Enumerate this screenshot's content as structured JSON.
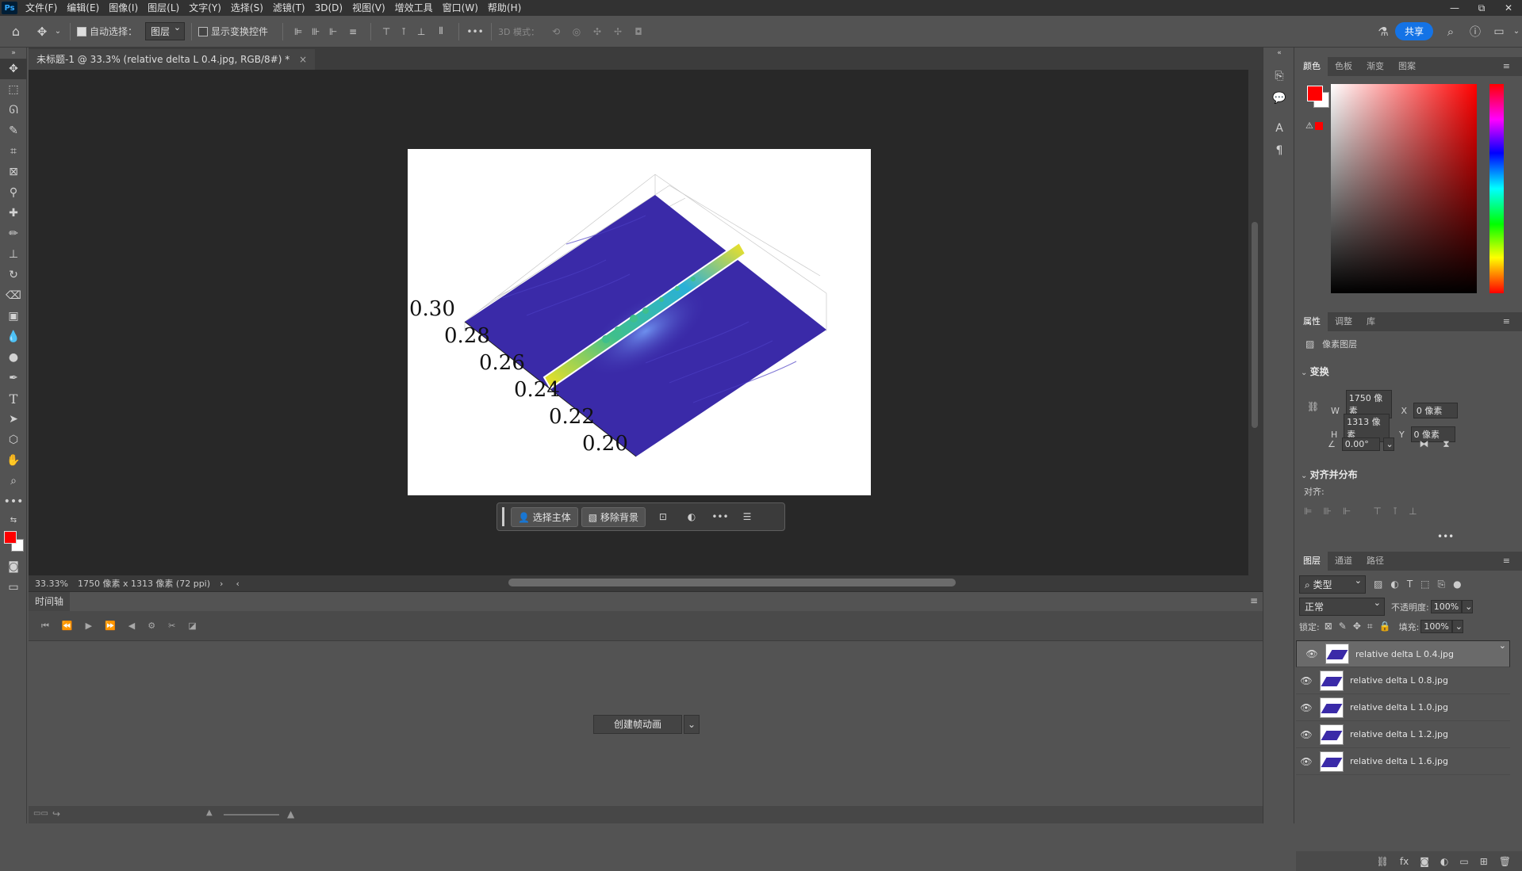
{
  "app": {
    "logo": "Ps"
  },
  "menu": [
    "文件(F)",
    "编辑(E)",
    "图像(I)",
    "图层(L)",
    "文字(Y)",
    "选择(S)",
    "滤镜(T)",
    "3D(D)",
    "视图(V)",
    "增效工具",
    "窗口(W)",
    "帮助(H)"
  ],
  "window_controls": {
    "minimize": "—",
    "restore": "⧉",
    "close": "✕"
  },
  "options": {
    "auto_select_label": "自动选择：",
    "auto_select_value": "图层",
    "show_transform_label": "显示变换控件",
    "mode_3d_label": "3D 模式：",
    "share_label": "共享"
  },
  "document": {
    "tab_title": "未标题-1 @ 33.3% (relative delta L 0.4.jpg, RGB/8#) *",
    "tab_close": "×"
  },
  "chart_data": {
    "type": "surface",
    "axis_tick_labels": [
      "0.30",
      "0.28",
      "0.26",
      "0.24",
      "0.22",
      "0.20"
    ],
    "colors": {
      "base": "#3a2aa8",
      "ridge_high": "#f7e31e",
      "ridge_mid": "#3fbf8c"
    }
  },
  "context_bar": {
    "select_subject": "选择主体",
    "remove_background": "移除背景",
    "more": "•••"
  },
  "status": {
    "zoom": "33.33%",
    "doc_size": "1750 像素 x 1313 像素 (72 ppi)",
    "arrow_right": "›",
    "arrow_left": "‹"
  },
  "timeline": {
    "tab": "时间轴",
    "create_button": "创建帧动画",
    "dropdown": "⌄"
  },
  "color_panel": {
    "tabs": [
      "颜色",
      "色板",
      "渐变",
      "图案"
    ],
    "fg_color": "#ff0000",
    "bg_color": "#ffffff"
  },
  "properties_panel": {
    "tabs": [
      "属性",
      "调整",
      "库"
    ],
    "layer_type": "像素图层",
    "transform_title": "变换",
    "w_label": "W",
    "w_value": "1750 像素",
    "h_label": "H",
    "h_value": "1313 像素",
    "x_label": "X",
    "x_value": "0 像素",
    "y_label": "Y",
    "y_value": "0 像素",
    "angle_value": "0.00°",
    "align_title": "对齐并分布",
    "align_label": "对齐:",
    "more": "•••"
  },
  "layers_panel": {
    "tabs": [
      "图层",
      "通道",
      "路径"
    ],
    "filter_value": "类型",
    "blend_mode": "正常",
    "opacity_label": "不透明度:",
    "opacity_value": "100%",
    "lock_label": "锁定:",
    "fill_label": "填充:",
    "fill_value": "100%",
    "layers": [
      {
        "name": "relative delta L 0.4.jpg",
        "selected": true
      },
      {
        "name": "relative delta L 0.8.jpg",
        "selected": false
      },
      {
        "name": "relative delta L 1.0.jpg",
        "selected": false
      },
      {
        "name": "relative delta L 1.2.jpg",
        "selected": false
      },
      {
        "name": "relative delta L 1.6.jpg",
        "selected": false
      }
    ]
  }
}
